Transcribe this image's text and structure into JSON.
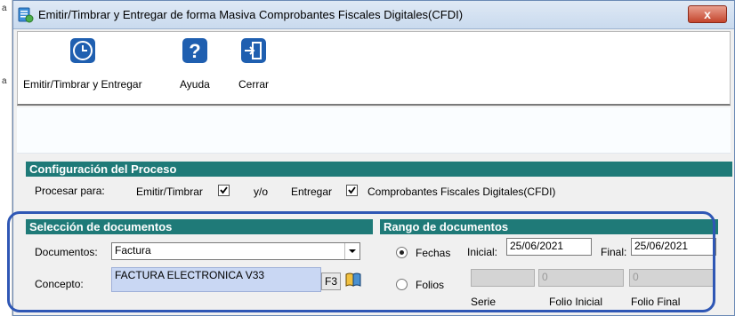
{
  "background_fragment": {
    "top": "a",
    "mid": "a"
  },
  "window": {
    "title": "Emitir/Timbrar y Entregar de forma Masiva Comprobantes Fiscales Digitales(CFDI)",
    "close_label": "x"
  },
  "toolbar": {
    "emit_label": "Emitir/Timbrar y Entregar",
    "help_label": "Ayuda",
    "close_label": "Cerrar"
  },
  "config": {
    "title": "Configuración del Proceso",
    "process_for": "Procesar para:",
    "emit_label": "Emitir/Timbrar",
    "emit_checked": true,
    "and_or": "y/o",
    "deliver_label": "Entregar",
    "deliver_checked": true,
    "cfdi_label": "Comprobantes Fiscales Digitales(CFDI)"
  },
  "selection": {
    "title": "Selección de documentos",
    "documents_label": "Documentos:",
    "documents_value": "Factura",
    "concept_label": "Concepto:",
    "concept_value": "FACTURA ELECTRONICA V33",
    "f3_label": "F3"
  },
  "range": {
    "title": "Rango de documentos",
    "dates_label": "Fechas",
    "dates_selected": true,
    "initial_label": "Inicial:",
    "initial_value": "25/06/2021",
    "final_label": "Final:",
    "final_value": "25/06/2021",
    "folios_label": "Folios",
    "folio_initial_value": "0",
    "folio_final_value": "0",
    "serie_header": "Serie",
    "folio_initial_header": "Folio Inicial",
    "folio_final_header": "Folio Final"
  },
  "colors": {
    "section_bar": "#1f7a78",
    "highlight_border": "#2f57b5",
    "icon_blue": "#1f5fb0"
  }
}
